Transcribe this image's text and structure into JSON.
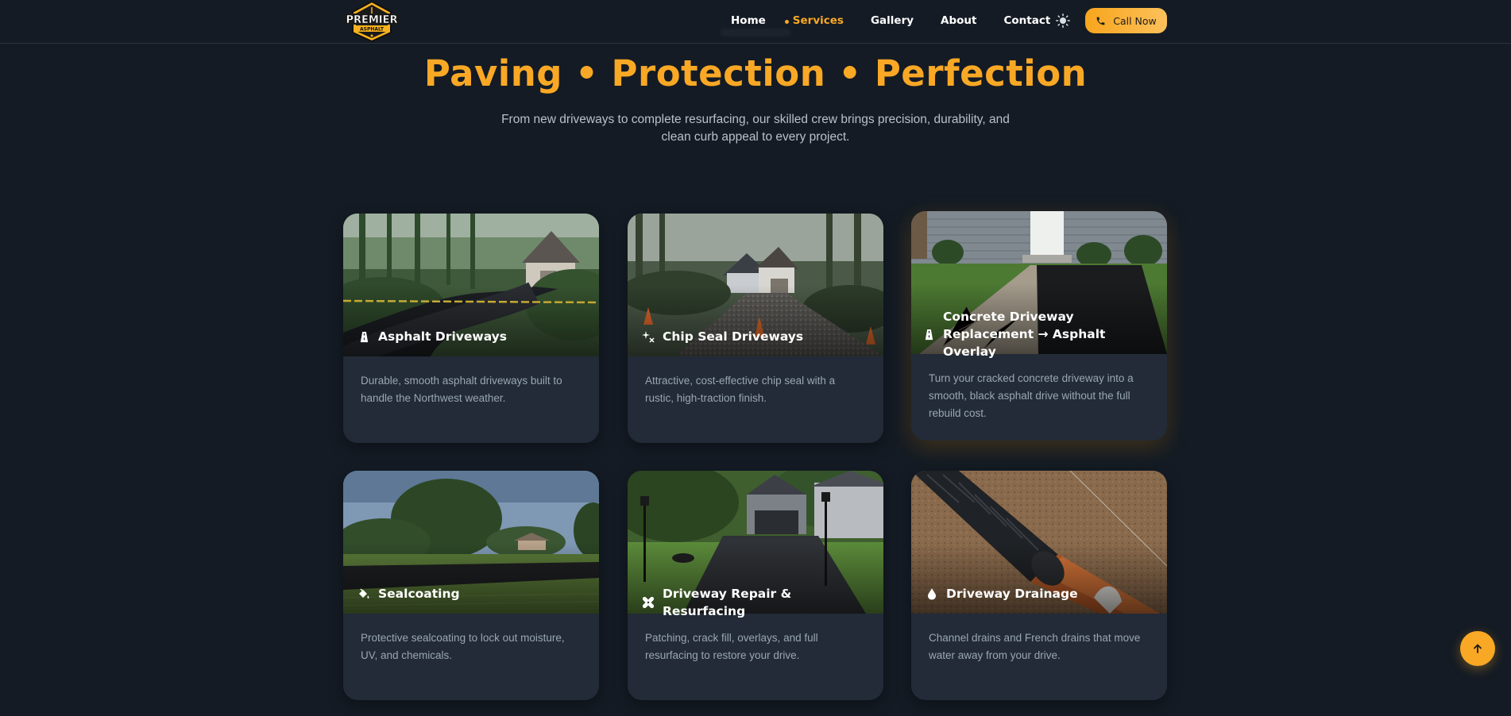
{
  "brand": {
    "logo_line1": "PREMIER",
    "logo_line2": "ASPHALT"
  },
  "nav": {
    "items": [
      "Home",
      "Services",
      "Gallery",
      "About",
      "Contact"
    ],
    "active": "Services"
  },
  "header": {
    "theme_icon": "sun-icon",
    "call_label": "Call Now",
    "call_icon": "phone-icon"
  },
  "hero": {
    "title": "Paving • Protection • Perfection",
    "subtitle": "From new driveways to complete resurfacing, our skilled crew brings precision, durability, and clean curb appeal to every project."
  },
  "services": [
    {
      "title": "Asphalt Driveways",
      "icon": "road-icon",
      "description": "Durable, smooth asphalt driveways built to handle the Northwest weather."
    },
    {
      "title": "Chip Seal Driveways",
      "icon": "sparkle-icon",
      "description": "Attractive, cost-effective chip seal with a rustic, high-traction finish."
    },
    {
      "title": "Concrete Driveway Replacement → Asphalt Overlay",
      "icon": "road-icon",
      "description": "Turn your cracked concrete driveway into a smooth, black asphalt drive without the full rebuild cost."
    },
    {
      "title": "Sealcoating",
      "icon": "paint-bucket-icon",
      "description": "Protective sealcoating to lock out moisture, UV, and chemicals."
    },
    {
      "title": "Driveway Repair & Resurfacing",
      "icon": "bandage-icon",
      "description": "Patching, crack fill, overlays, and full resurfacing to restore your drive."
    },
    {
      "title": "Driveway Drainage",
      "icon": "droplet-icon",
      "description": "Channel drains and French drains that move water away from your drive."
    }
  ],
  "back_to_top": {
    "icon": "arrow-up-icon"
  },
  "colors": {
    "accent": "#f9a825",
    "background": "#141b24",
    "card": "#222b37"
  }
}
